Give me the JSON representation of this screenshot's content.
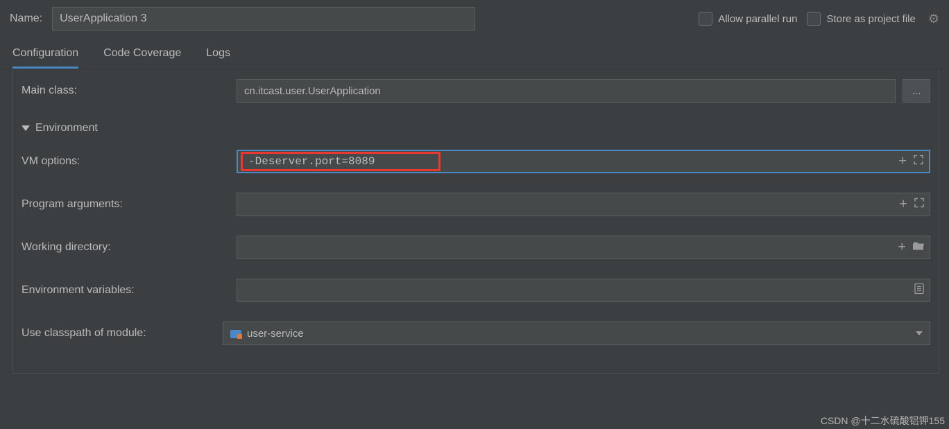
{
  "header": {
    "name_label": "Name:",
    "name_value": "UserApplication 3",
    "allow_parallel_run": "Allow parallel run",
    "store_as_project_file": "Store as project file"
  },
  "tabs": [
    {
      "label": "Configuration",
      "active": true
    },
    {
      "label": "Code Coverage",
      "active": false
    },
    {
      "label": "Logs",
      "active": false
    }
  ],
  "config": {
    "main_class_label": "Main class:",
    "main_class_value": "cn.itcast.user.UserApplication",
    "browse_label": "...",
    "environment_section": "Environment",
    "vm_options_label": "VM options:",
    "vm_options_value": "-Deserver.port=8089",
    "program_arguments_label": "Program arguments:",
    "program_arguments_value": "",
    "working_directory_label": "Working directory:",
    "working_directory_value": "",
    "env_variables_label": "Environment variables:",
    "env_variables_value": "",
    "classpath_label": "Use classpath of module:",
    "classpath_value": "user-service"
  },
  "watermark": "CSDN @十二水硫酸铝钾155"
}
